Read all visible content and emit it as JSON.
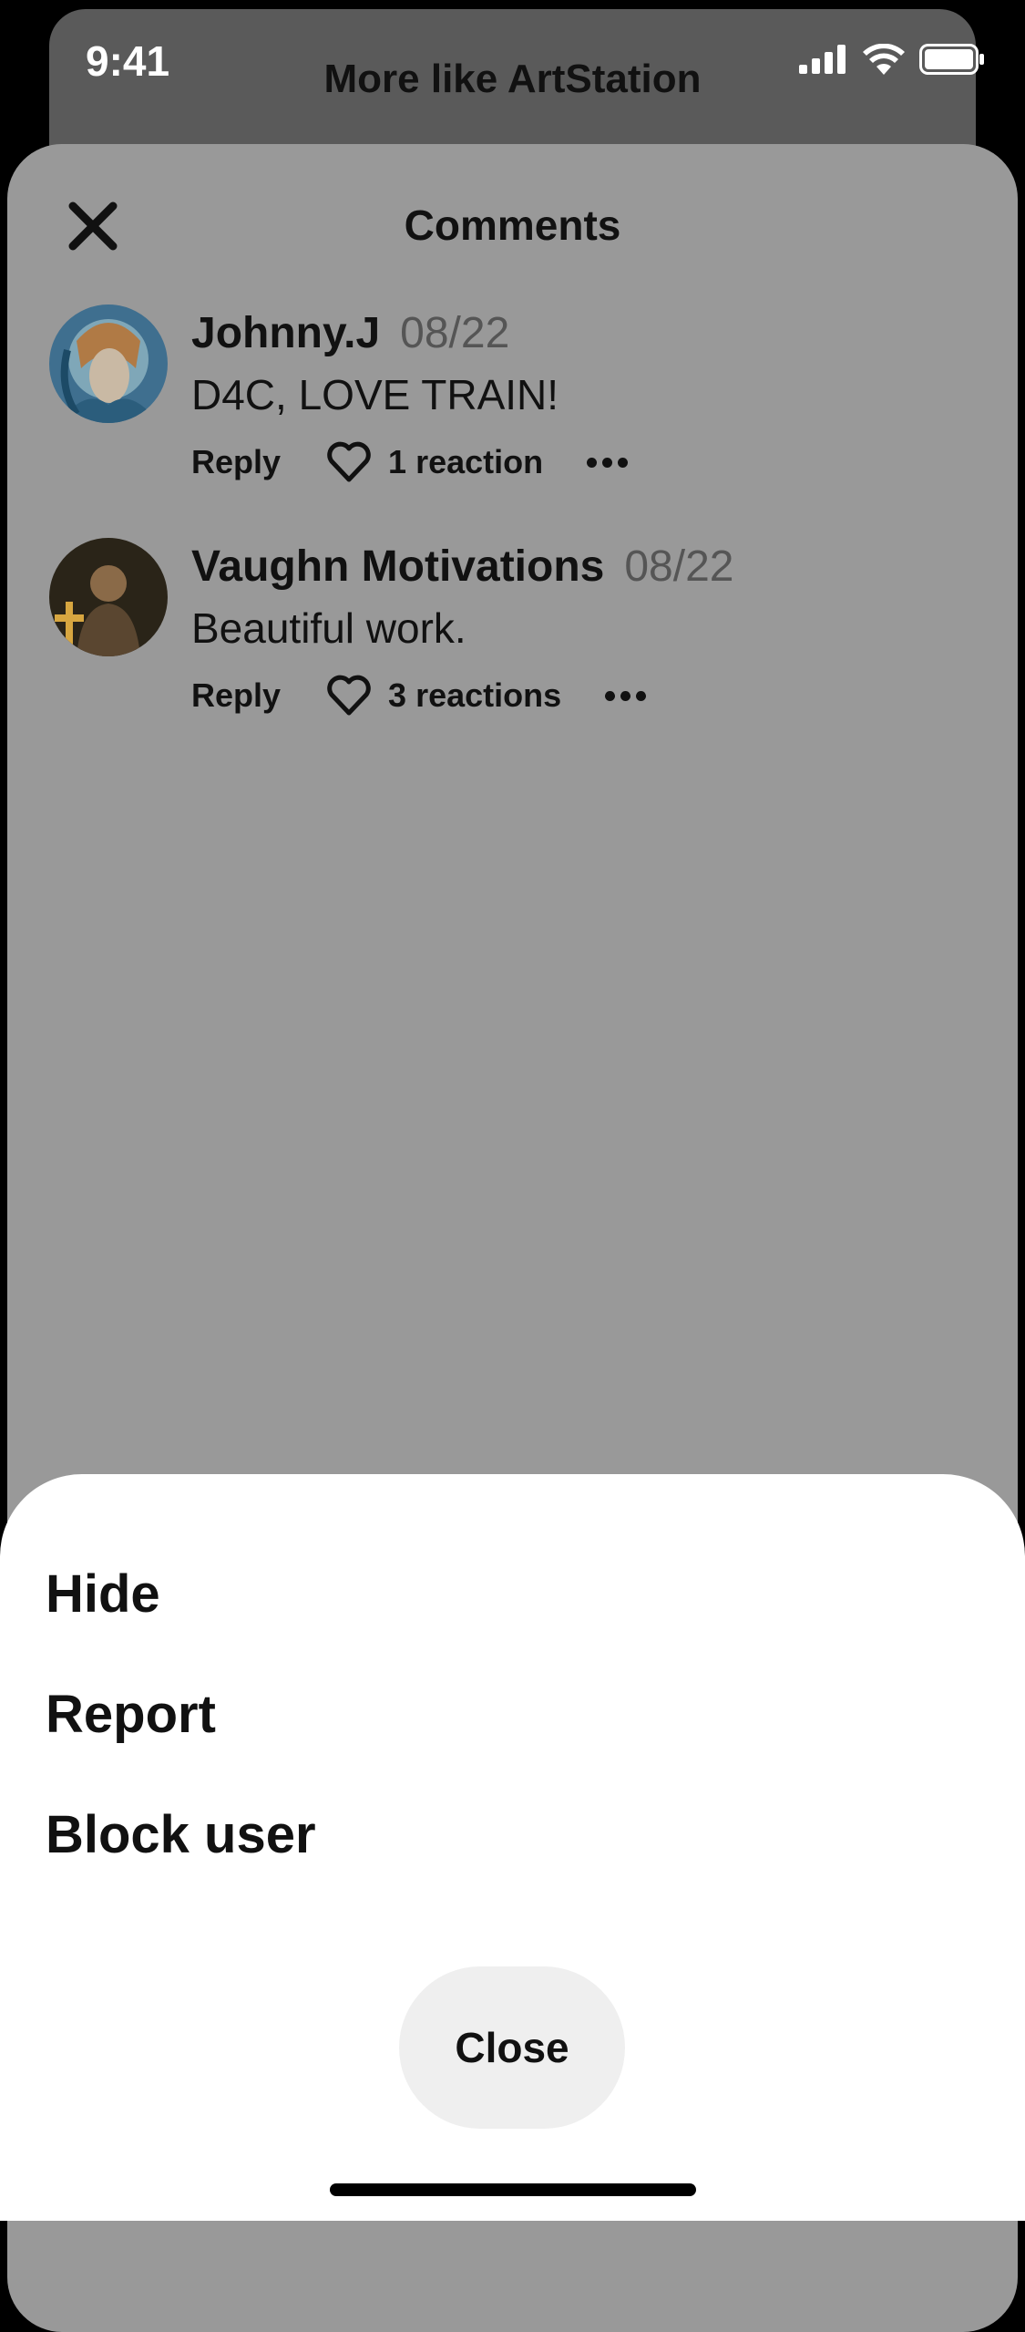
{
  "status_bar": {
    "time": "9:41"
  },
  "parent": {
    "title": "More like ArtStation"
  },
  "comments_sheet": {
    "title": "Comments",
    "comments": [
      {
        "author": "Johnny.J",
        "date": "08/22",
        "text": "D4C, LOVE TRAIN!",
        "reply_label": "Reply",
        "reactions": "1 reaction"
      },
      {
        "author": "Vaughn Motivations",
        "date": "08/22",
        "text": "Beautiful work.",
        "reply_label": "Reply",
        "reactions": "3 reactions"
      }
    ]
  },
  "action_sheet": {
    "options": [
      "Hide",
      "Report",
      "Block user"
    ],
    "close_label": "Close"
  }
}
